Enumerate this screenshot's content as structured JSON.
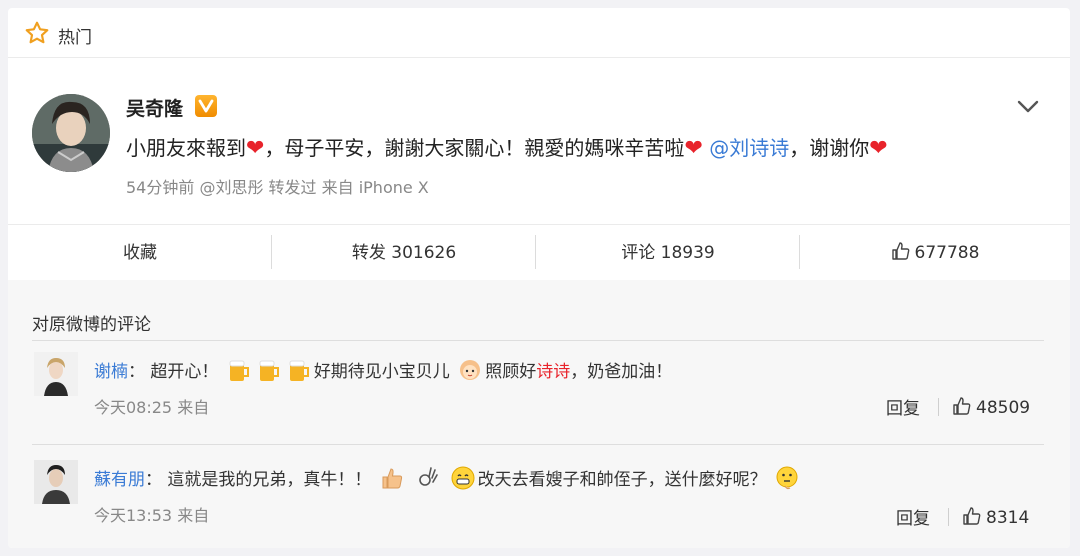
{
  "hot_bar": {
    "label": "热门",
    "icon": "star-icon"
  },
  "post": {
    "author": "吴奇隆",
    "verified_badge_icon": "verified-v-icon",
    "text_1": "小朋友來報到",
    "text_2": "，母子平安，謝謝大家關心！親愛的媽咪辛苦啦",
    "mention": "@刘诗诗",
    "text_3": "，谢谢你",
    "meta": "54分钟前 @刘思彤 转发过 来自 iPhone X",
    "colors": {
      "mention": "#3a7bd5",
      "heart": "#e8232b",
      "badge": "#f39c12"
    }
  },
  "actions": {
    "favorite": "收藏",
    "repost": "转发 301626",
    "comment": "评论 18939",
    "like": "677788"
  },
  "comments": {
    "header": "对原微博的评论",
    "items": [
      {
        "user": "谢楠",
        "text_1": "：  超开心！",
        "text_2": "好期待见小宝贝儿",
        "text_3": "照顾好",
        "highlight": "诗诗",
        "text_4": "，奶爸加油！",
        "time": "今天08:25 来自",
        "reply": "回复",
        "likes": "48509"
      },
      {
        "user": "蘇有朋",
        "text_1": "：  這就是我的兄弟，真牛！！",
        "text_2": "改天去看嫂子和帥侄子，送什麼好呢？",
        "time": "今天13:53 来自",
        "reply": "回复",
        "likes": "8314"
      }
    ]
  }
}
